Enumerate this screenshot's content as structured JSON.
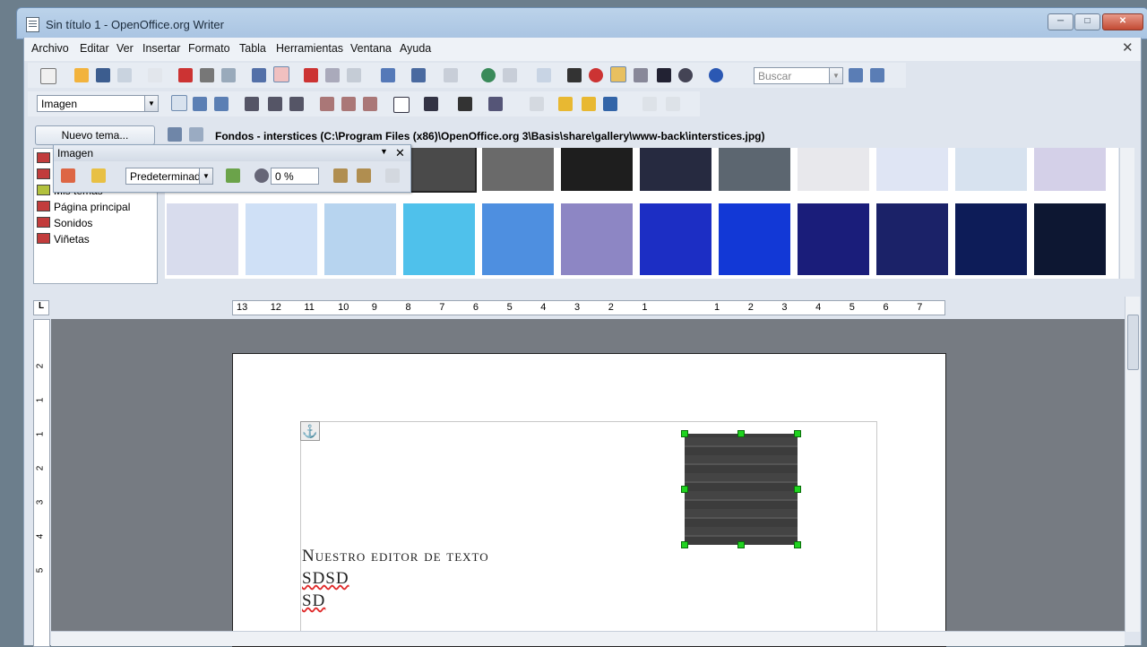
{
  "window": {
    "title": "Sin título 1 - OpenOffice.org Writer",
    "min": "─",
    "max": "□",
    "close": "✕"
  },
  "menu": [
    "Archivo",
    "Editar",
    "Ver",
    "Insertar",
    "Formato",
    "Tabla",
    "Herramientas",
    "Ventana",
    "Ayuda"
  ],
  "doc_close": "✕",
  "toolbar": {
    "search_placeholder": "Buscar",
    "style_value": "Imagen"
  },
  "gallery": {
    "new_theme_label": "Nuevo tema...",
    "path": "Fondos - interstices (C:\\Program Files (x86)\\OpenOffice.org 3\\Basis\\share\\gallery\\www-back\\interstices.jpg)",
    "themes": [
      "Mis temas",
      "Página principal",
      "Sonidos",
      "Viñetas"
    ],
    "thumb_colors": [
      [
        "#d8d8d8",
        "#9a9aa8",
        "#8c8c8c",
        "#4a4a4a",
        "#6a6a6a",
        "#1e1e1e",
        "#262a40",
        "#5c6670",
        "#e8e8ec",
        "#dfe5f4",
        "#d7e2ef",
        "#d4d0e8"
      ],
      [
        "#d8dced",
        "#cfe0f6",
        "#b7d4ef",
        "#4fc1eb",
        "#4e8fe0",
        "#8d86c4",
        "#1c2ec4",
        "#1238d6",
        "#1a1d7a",
        "#1b2268",
        "#0d1c58",
        "#0d1732"
      ]
    ]
  },
  "imagen_bar": {
    "title": "Imagen",
    "mode": "Predeterminad",
    "transparency": "0 %",
    "close": "✕"
  },
  "ruler": {
    "left_ticks": [
      "13",
      "12",
      "11",
      "10",
      "9",
      "8",
      "7",
      "6",
      "5",
      "4",
      "3",
      "2",
      "1"
    ],
    "right_ticks": [
      "1",
      "2",
      "3",
      "4",
      "5",
      "6",
      "7"
    ],
    "corner": "L"
  },
  "vruler_ticks": [
    "2",
    "1",
    "1",
    "2",
    "3",
    "4",
    "5"
  ],
  "document": {
    "lines": [
      "Nuestro editor de texto",
      "SDSD",
      "SD"
    ]
  }
}
